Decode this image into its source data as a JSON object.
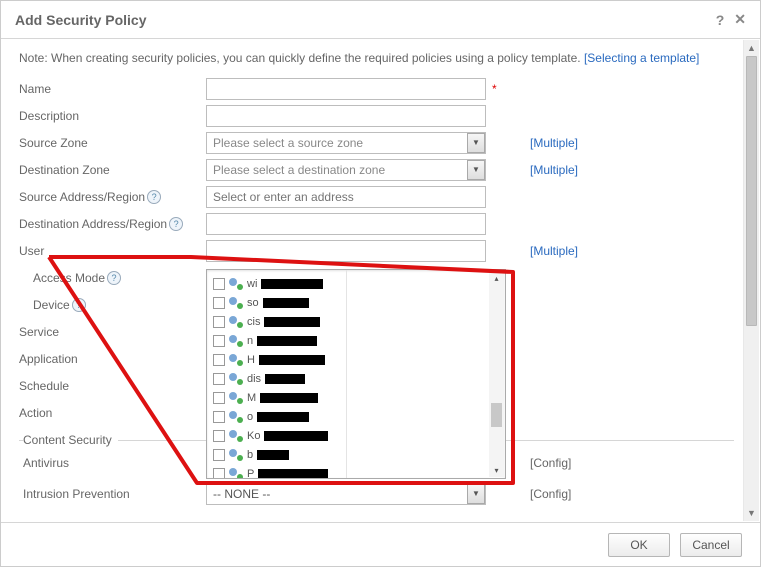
{
  "header": {
    "title": "Add Security Policy"
  },
  "note": {
    "text": "Note: When creating security policies, you can quickly define the required policies using a policy template. ",
    "link": "[Selecting a template]"
  },
  "labels": {
    "name": "Name",
    "description": "Description",
    "sourceZone": "Source Zone",
    "destZone": "Destination Zone",
    "sourceAddr": "Source Address/Region",
    "destAddr": "Destination Address/Region",
    "user": "User",
    "accessMode": "Access Mode",
    "device": "Device",
    "service": "Service",
    "application": "Application",
    "schedule": "Schedule",
    "action": "Action",
    "contentSecurity": "Content Security",
    "antivirus": "Antivirus",
    "intrusion": "Intrusion Prevention"
  },
  "placeholders": {
    "sourceZone": "Please select a source zone",
    "destZone": "Please select a destination zone",
    "sourceAddr": "Select or enter an address",
    "none": "-- NONE --"
  },
  "links": {
    "multiple": "[Multiple]",
    "config": "[Config]"
  },
  "userList": [
    {
      "prefix": "wi",
      "redactW": 62
    },
    {
      "prefix": "so",
      "redactW": 46
    },
    {
      "prefix": "cis",
      "redactW": 56
    },
    {
      "prefix": "n",
      "redactW": 60
    },
    {
      "prefix": "H",
      "redactW": 66
    },
    {
      "prefix": "dis",
      "redactW": 40
    },
    {
      "prefix": "M",
      "redactW": 58
    },
    {
      "prefix": "o",
      "redactW": 52
    },
    {
      "prefix": "Ko",
      "redactW": 64
    },
    {
      "prefix": "b",
      "redactW": 32
    },
    {
      "prefix": "P",
      "redactW": 70
    }
  ],
  "buttons": {
    "ok": "OK",
    "cancel": "Cancel"
  }
}
